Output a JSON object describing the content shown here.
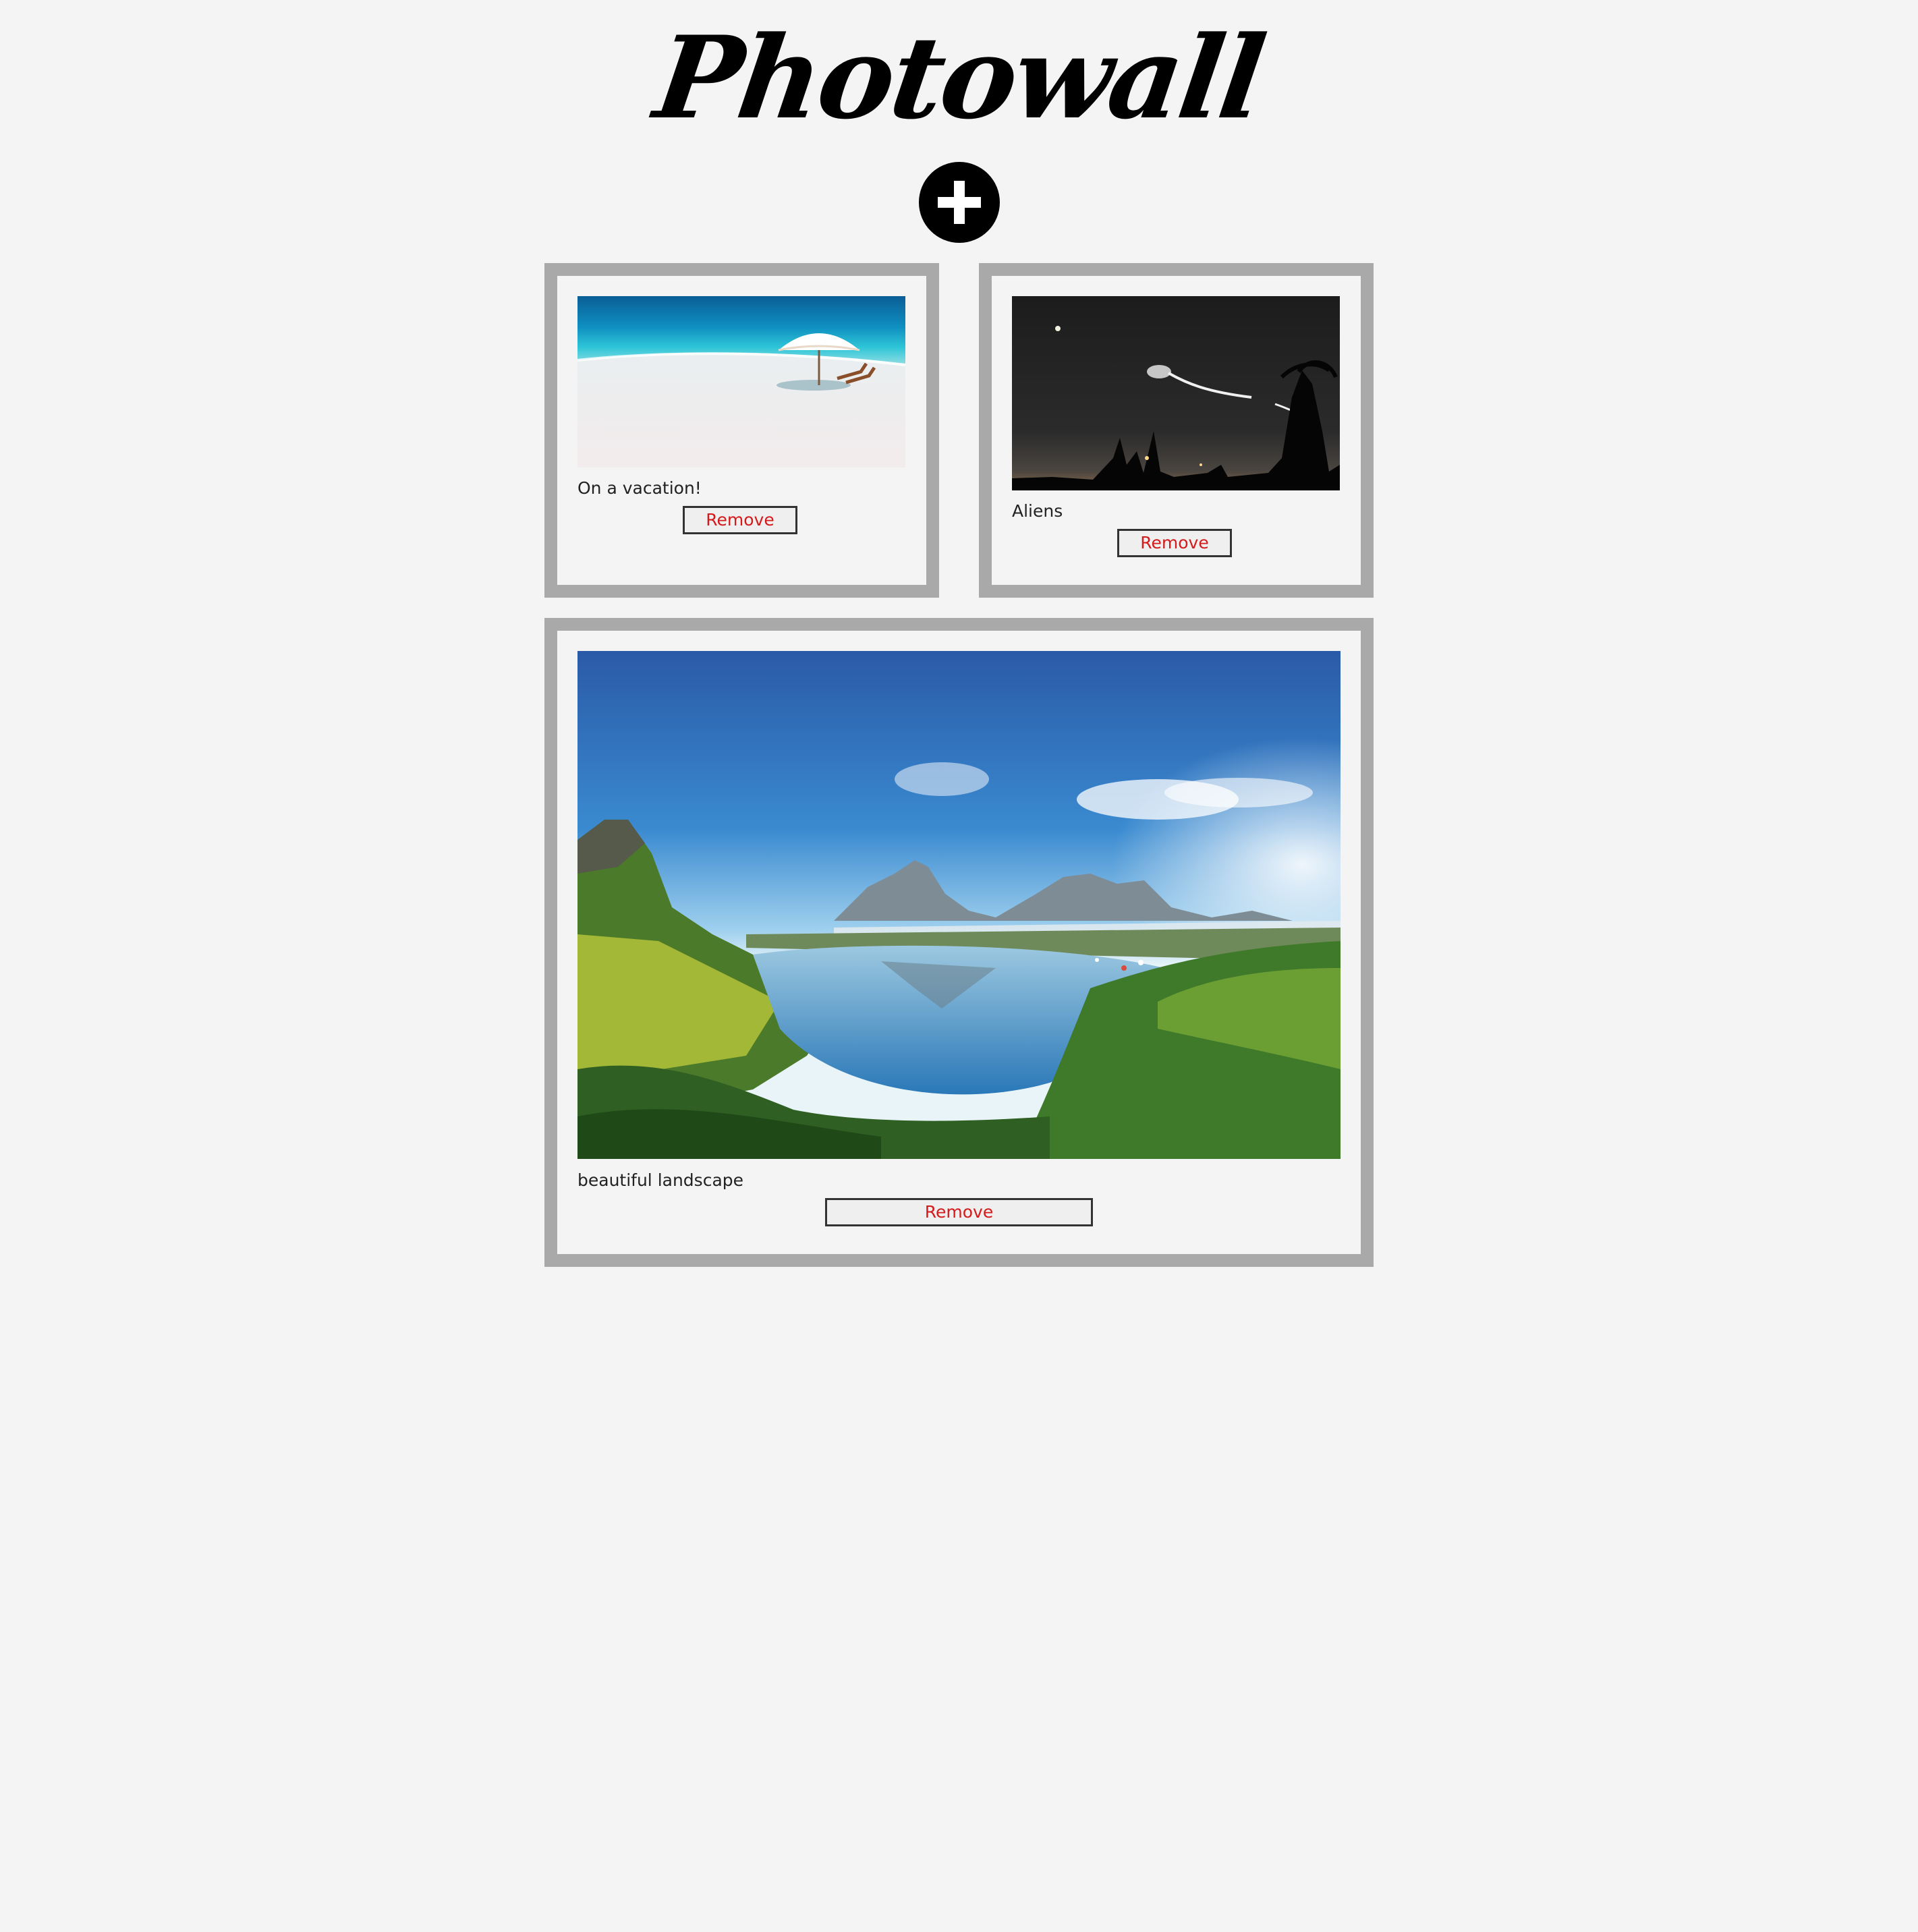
{
  "app": {
    "title": "Photowall",
    "add_icon": "plus-circle-icon"
  },
  "posts": [
    {
      "caption": "On a vacation!",
      "image": "beach-umbrella-photo",
      "remove_label": "Remove"
    },
    {
      "caption": "Aliens",
      "image": "night-sky-lights-photo",
      "remove_label": "Remove"
    },
    {
      "caption": "beautiful landscape",
      "image": "mountain-lake-landscape-photo",
      "remove_label": "Remove"
    }
  ],
  "colors": {
    "background": "#f4f4f4",
    "frame": "#a9a9a9",
    "remove_text": "#d41a1a"
  }
}
